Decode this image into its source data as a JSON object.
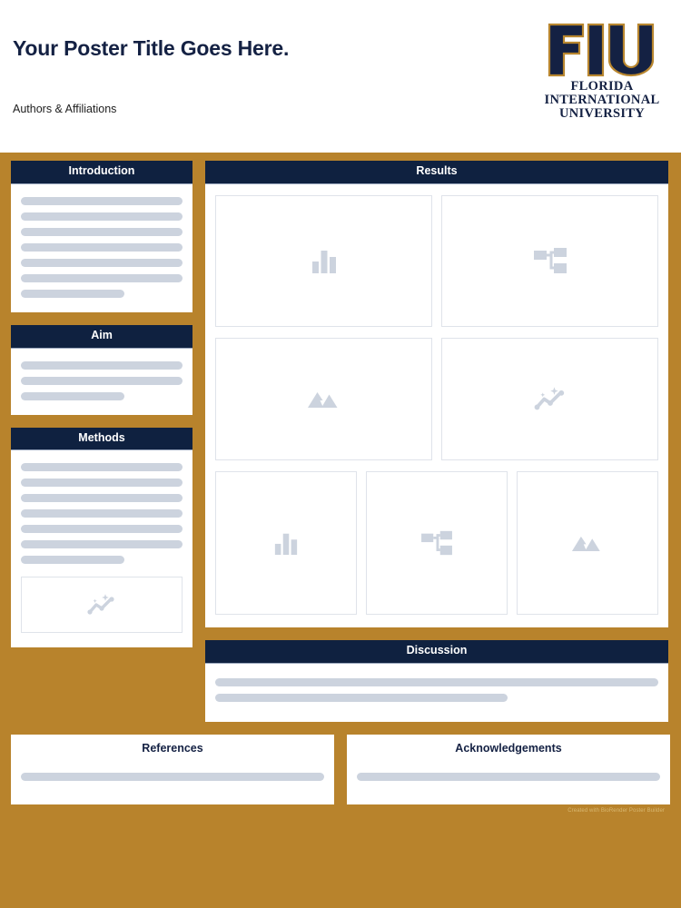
{
  "header": {
    "title": "Your Poster Title Goes Here.",
    "authors": "Authors & Affiliations",
    "logo": {
      "mark_text": "FIU",
      "line1": "FLORIDA",
      "line2": "INTERNATIONAL",
      "line3": "UNIVERSITY"
    }
  },
  "colors": {
    "gold": "#b8832c",
    "navy": "#0f2140",
    "logo_navy": "#142143",
    "skeleton": "#ccd3de",
    "placeholder_border": "#dfe3ea",
    "credit": "#d8b76f"
  },
  "sections": {
    "introduction": {
      "title": "Introduction",
      "lines": [
        100,
        100,
        100,
        100,
        100,
        100,
        64
      ]
    },
    "aim": {
      "title": "Aim",
      "lines": [
        100,
        100,
        64
      ]
    },
    "methods": {
      "title": "Methods",
      "lines": [
        100,
        100,
        100,
        100,
        100,
        100,
        64
      ],
      "image_icon": "sparkle-line-chart-icon"
    },
    "results": {
      "title": "Results",
      "rows": [
        {
          "icons": [
            "bar-chart-icon",
            "flowchart-icon"
          ]
        },
        {
          "icons": [
            "mountain-image-icon",
            "sparkle-line-chart-icon"
          ]
        },
        {
          "icons": [
            "bar-chart-icon",
            "flowchart-icon",
            "mountain-image-icon"
          ]
        }
      ]
    },
    "discussion": {
      "title": "Discussion",
      "lines": [
        100,
        66
      ]
    },
    "references": {
      "title": "References",
      "lines": [
        100
      ]
    },
    "acknowledgements": {
      "title": "Acknowledgements",
      "lines": [
        100
      ]
    }
  },
  "footer": {
    "credit": "Created with BioRender Poster Builder"
  }
}
